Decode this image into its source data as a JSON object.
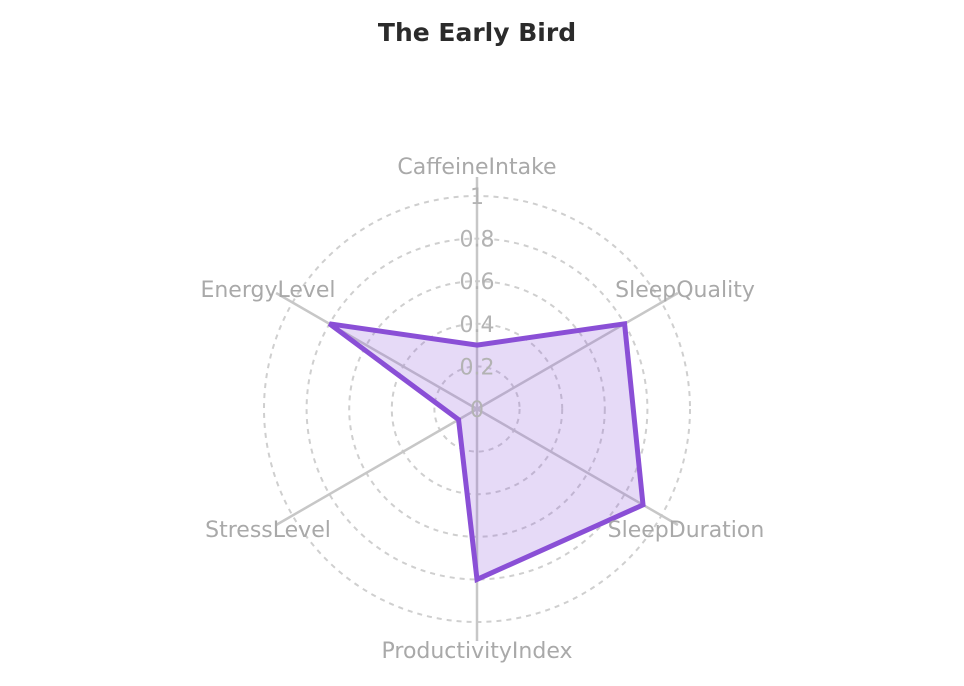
{
  "chart_data": {
    "type": "radar",
    "title": "The Early Bird",
    "axes": [
      "CaffeineIntake",
      "SleepQuality",
      "SleepDuration",
      "ProductivityIndex",
      "StressLevel",
      "EnergyLevel"
    ],
    "ticks": [
      "0",
      "0.2",
      "0.4",
      "0.6",
      "0.8",
      "1"
    ],
    "range": [
      0,
      1
    ],
    "grid": "dashed circles",
    "series": [
      {
        "values": [
          0.3,
          0.8,
          0.9,
          0.8,
          0.1,
          0.8
        ],
        "color": "#8a4fd6"
      }
    ]
  }
}
